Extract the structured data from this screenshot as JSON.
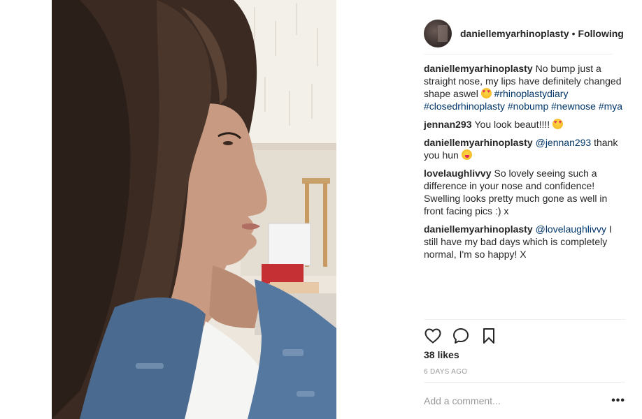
{
  "post": {
    "username": "daniellemyarhinoplasty",
    "separator": "•",
    "follow_status": "Following"
  },
  "comments": [
    {
      "user": "daniellemyarhinoplasty",
      "text": "No bump just a straight nose, my lips have definitely changed shape aswel",
      "emoji": "heart-eyes-emoji",
      "tags": [
        "#rhinoplastydiary",
        "#closedrhinoplasty",
        "#nobump",
        "#newnose",
        "#mya"
      ]
    },
    {
      "user": "jennan293",
      "text": "You look beaut!!!!",
      "emoji": "heart-eyes-emoji"
    },
    {
      "user": "daniellemyarhinoplasty",
      "mention": "@jennan293",
      "text": "thank you hun",
      "emoji": "yum-emoji"
    },
    {
      "user": "lovelaughlivvy",
      "text": "So lovely seeing such a difference in your nose and confidence! Swelling looks pretty much gone as well in front facing pics :) x"
    },
    {
      "user": "daniellemyarhinoplasty",
      "mention": "@lovelaughlivvy",
      "text": "I still have my bad days which is completely normal, I'm so happy! X"
    }
  ],
  "actions": {
    "like_icon": "heart-icon",
    "comment_icon": "speech-bubble-icon",
    "save_icon": "bookmark-icon"
  },
  "likes": "38 likes",
  "time": "6 DAYS AGO",
  "add_comment": {
    "placeholder": "Add a comment...",
    "more_label": "•••"
  },
  "colors": {
    "link": "#003569",
    "text": "#262626",
    "muted": "#999999",
    "divider": "#efefef"
  }
}
